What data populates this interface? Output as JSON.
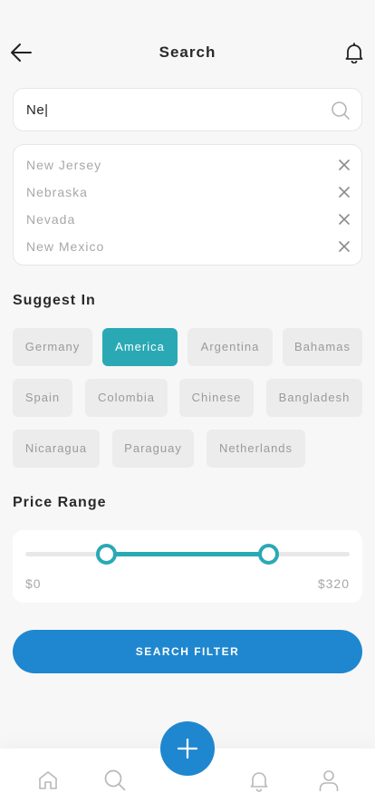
{
  "header": {
    "title": "Search"
  },
  "search": {
    "value": "Ne|",
    "placeholder": ""
  },
  "results": [
    {
      "label": "New Jersey"
    },
    {
      "label": "Nebraska"
    },
    {
      "label": "Nevada"
    },
    {
      "label": "New Mexico"
    }
  ],
  "suggest": {
    "title": "Suggest In",
    "chips": [
      {
        "label": "Germany",
        "selected": false
      },
      {
        "label": "America",
        "selected": true
      },
      {
        "label": "Argentina",
        "selected": false
      },
      {
        "label": "Bahamas",
        "selected": false
      },
      {
        "label": "Spain",
        "selected": false
      },
      {
        "label": "Colombia",
        "selected": false
      },
      {
        "label": "Chinese",
        "selected": false
      },
      {
        "label": "Bangladesh",
        "selected": false
      },
      {
        "label": "Nicaragua",
        "selected": false
      },
      {
        "label": "Paraguay",
        "selected": false
      },
      {
        "label": "Netherlands",
        "selected": false
      }
    ]
  },
  "price": {
    "title": "Price Range",
    "min_label": "$0",
    "max_label": "$320",
    "min": 0,
    "max": 320,
    "low_fraction": 0.25,
    "high_fraction": 0.75
  },
  "actions": {
    "search_filter_label": "SEARCH FILTER"
  },
  "colors": {
    "accent": "#2aa9b5",
    "primary": "#1f87cf",
    "background": "#f7f7f7"
  },
  "icons": {
    "back": "arrow-left-icon",
    "notification": "bell-icon",
    "search": "search-icon",
    "clear": "close-icon",
    "add": "plus-icon",
    "home": "home-icon",
    "profile": "user-icon"
  }
}
